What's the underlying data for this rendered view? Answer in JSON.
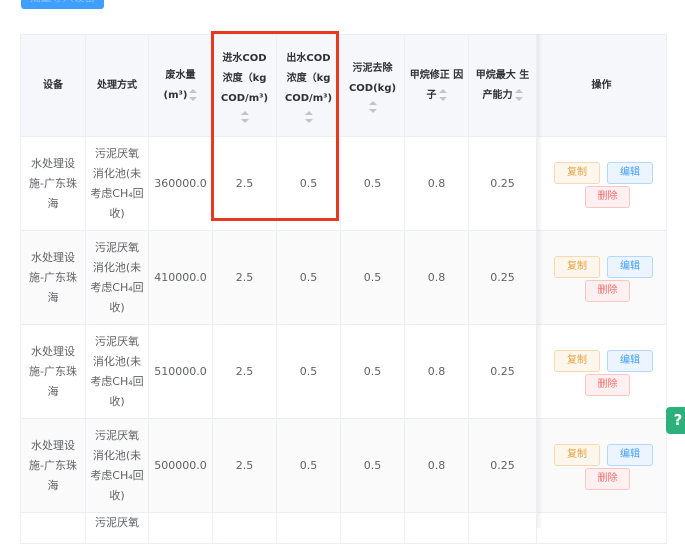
{
  "top_button": {
    "label": "批量导入设备"
  },
  "table": {
    "headers": [
      {
        "label": "设备",
        "sortable": false
      },
      {
        "label": "处理方式",
        "sortable": false
      },
      {
        "label": "废水量 (m³)",
        "sortable": true
      },
      {
        "label": "进水COD 浓度（kg COD/m³)",
        "sortable": true
      },
      {
        "label": "出水COD 浓度（kg COD/m³)",
        "sortable": true
      },
      {
        "label": "污泥去除 COD(kg)",
        "sortable": true
      },
      {
        "label": "甲烷修正 因子",
        "sortable": true
      },
      {
        "label": "甲烷最大 生产能力",
        "sortable": true
      },
      {
        "label": "操作",
        "sortable": false
      }
    ],
    "rows": [
      {
        "device": "水处理设施-广东珠海",
        "method": "污泥厌氧消化池(未考虑CH₄回收)",
        "wastewater": "360000.0",
        "cod_in": "2.5",
        "cod_out": "0.5",
        "sludge_cod": "0.5",
        "mcf": "0.8",
        "bo": "0.25"
      },
      {
        "device": "水处理设施-广东珠海",
        "method": "污泥厌氧消化池(未考虑CH₄回收)",
        "wastewater": "410000.0",
        "cod_in": "2.5",
        "cod_out": "0.5",
        "sludge_cod": "0.5",
        "mcf": "0.8",
        "bo": "0.25"
      },
      {
        "device": "水处理设施-广东珠海",
        "method": "污泥厌氧消化池(未考虑CH₄回收)",
        "wastewater": "510000.0",
        "cod_in": "2.5",
        "cod_out": "0.5",
        "sludge_cod": "0.5",
        "mcf": "0.8",
        "bo": "0.25"
      },
      {
        "device": "水处理设施-广东珠海",
        "method": "污泥厌氧消化池(未考虑CH₄回收)",
        "wastewater": "500000.0",
        "cod_in": "2.5",
        "cod_out": "0.5",
        "sludge_cod": "0.5",
        "mcf": "0.8",
        "bo": "0.25"
      }
    ],
    "partial_row": {
      "method": "污泥厌氧"
    },
    "actions": {
      "copy": "复制",
      "edit": "编辑",
      "delete": "删除"
    }
  },
  "help_button": {
    "label": "?"
  },
  "colors": {
    "highlight": "#e53a1f",
    "primary": "#409eff",
    "warning": "#e6a23c",
    "danger": "#f56c6c",
    "help": "#2eb07d"
  }
}
